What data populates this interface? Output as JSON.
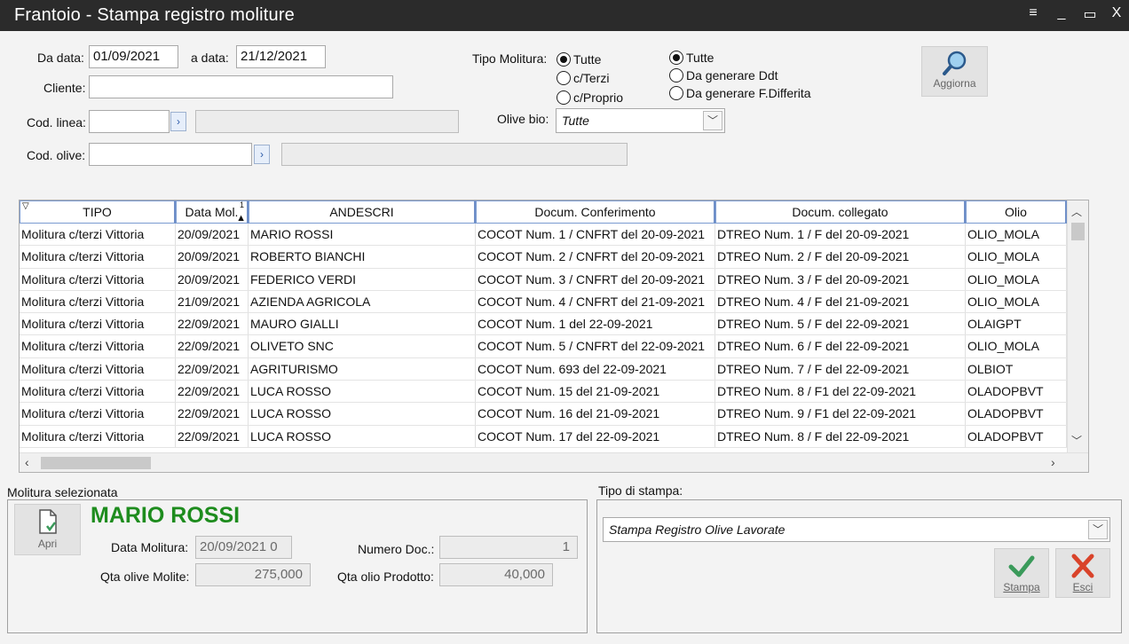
{
  "window": {
    "title": "Frantoio - Stampa registro moliture",
    "controls": {
      "menu": "≡",
      "minimize": "_",
      "maximize": "▭",
      "close": "X"
    }
  },
  "filters": {
    "da_data_label": "Da data:",
    "da_data_value": "01/09/2021",
    "a_data_label": "a data:",
    "a_data_value": "21/12/2021",
    "cliente_label": "Cliente:",
    "cliente_value": "",
    "cod_linea_label": "Cod. linea:",
    "cod_linea_value": "",
    "cod_linea_desc": "",
    "cod_olive_label": "Cod. olive:",
    "cod_olive_value": "",
    "cod_olive_desc": "",
    "tipo_molitura_label": "Tipo Molitura:",
    "tipo_molitura_options": [
      {
        "label": "Tutte",
        "selected": true
      },
      {
        "label": "c/Terzi",
        "selected": false
      },
      {
        "label": "c/Proprio",
        "selected": false
      }
    ],
    "tipo_doc_options": [
      {
        "label": "Tutte",
        "selected": true
      },
      {
        "label": "Da generare Ddt",
        "selected": false
      },
      {
        "label": "Da generare F.Differita",
        "selected": false
      }
    ],
    "olive_bio_label": "Olive bio:",
    "olive_bio_value": "Tutte",
    "aggiorna_label": "Aggiorna"
  },
  "grid": {
    "columns": [
      "TIPO",
      "Data Mol.",
      "ANDESCRI",
      "Docum. Conferimento",
      "Docum. collegato",
      "Olio"
    ],
    "sort_indicator": "1",
    "rows": [
      [
        "Molitura c/terzi Vittoria",
        "20/09/2021",
        "MARIO ROSSI",
        "COCOT Num. 1 / CNFRT del 20-09-2021",
        "DTREO Num. 1 / F del 20-09-2021",
        "OLIO_MOLA"
      ],
      [
        "Molitura c/terzi Vittoria",
        "20/09/2021",
        "ROBERTO BIANCHI",
        "COCOT Num. 2 / CNFRT del 20-09-2021",
        "DTREO Num. 2 / F del 20-09-2021",
        "OLIO_MOLA"
      ],
      [
        "Molitura c/terzi Vittoria",
        "20/09/2021",
        "FEDERICO VERDI",
        "COCOT Num. 3 / CNFRT del 20-09-2021",
        "DTREO Num. 3 / F del 20-09-2021",
        "OLIO_MOLA"
      ],
      [
        "Molitura c/terzi Vittoria",
        "21/09/2021",
        "AZIENDA AGRICOLA",
        "COCOT Num. 4 / CNFRT del 21-09-2021",
        "DTREO Num. 4 / F del 21-09-2021",
        "OLIO_MOLA"
      ],
      [
        "Molitura c/terzi Vittoria",
        "22/09/2021",
        "MAURO GIALLI",
        "COCOT Num. 1  del 22-09-2021",
        "DTREO Num. 5 / F del 22-09-2021",
        "OLAIGPT"
      ],
      [
        "Molitura c/terzi Vittoria",
        "22/09/2021",
        "OLIVETO SNC",
        "COCOT Num. 5 / CNFRT del 22-09-2021",
        "DTREO Num. 6 / F del 22-09-2021",
        "OLIO_MOLA"
      ],
      [
        "Molitura c/terzi Vittoria",
        "22/09/2021",
        "AGRITURISMO",
        "COCOT Num. 693  del 22-09-2021",
        "DTREO Num. 7 / F del 22-09-2021",
        "OLBIOT"
      ],
      [
        "Molitura c/terzi Vittoria",
        "22/09/2021",
        "LUCA ROSSO",
        "COCOT Num. 15  del 21-09-2021",
        "DTREO Num. 8 / F1 del 22-09-2021",
        "OLADOPBVT"
      ],
      [
        "Molitura c/terzi Vittoria",
        "22/09/2021",
        "LUCA ROSSO",
        "COCOT Num. 16  del 21-09-2021",
        "DTREO Num. 9 / F1 del 22-09-2021",
        "OLADOPBVT"
      ],
      [
        "Molitura c/terzi Vittoria",
        "22/09/2021",
        "LUCA ROSSO",
        "COCOT Num. 17  del 22-09-2021",
        "DTREO Num. 8 / F del 22-09-2021",
        "OLADOPBVT"
      ]
    ]
  },
  "selected": {
    "section_label": "Molitura selezionata",
    "name": "MARIO ROSSI",
    "apri_label": "Apri",
    "data_molitura_label": "Data Molitura:",
    "data_molitura_value": "20/09/2021 0",
    "numero_doc_label": "Numero Doc.:",
    "numero_doc_value": "1",
    "qta_olive_label": "Qta olive Molite:",
    "qta_olive_value": "275,000",
    "qta_olio_label": "Qta olio Prodotto:",
    "qta_olio_value": "40,000",
    "name_color": "#1e8c1e"
  },
  "print": {
    "section_label": "Tipo di stampa:",
    "tipo_value": "Stampa Registro Olive Lavorate",
    "stampa_label": "Stampa",
    "esci_label": "Esci",
    "stampa_color": "#3a9a5a",
    "esci_color": "#d9432a"
  }
}
